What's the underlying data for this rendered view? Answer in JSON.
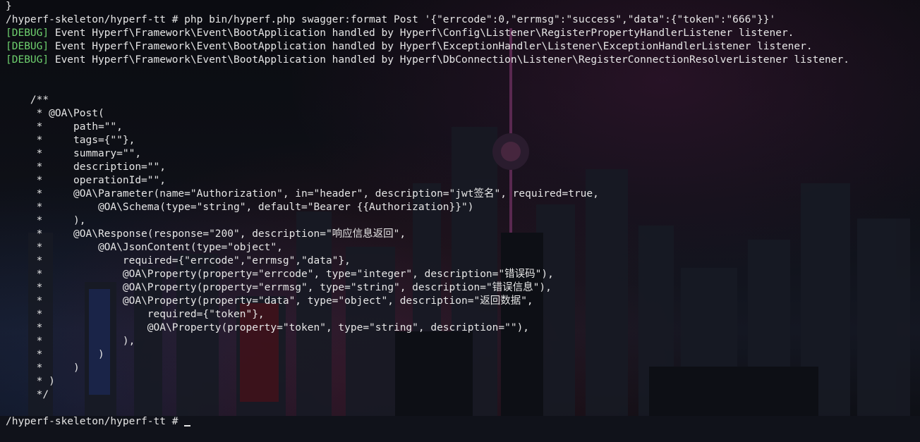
{
  "terminal": {
    "lines": [
      {
        "tag": "",
        "text": "}"
      },
      {
        "tag": "",
        "text": "/hyperf-skeleton/hyperf-tt # php bin/hyperf.php swagger:format Post '{\"errcode\":0,\"errmsg\":\"success\",\"data\":{\"token\":\"666\"}}'"
      },
      {
        "tag": "[DEBUG]",
        "text": " Event Hyperf\\Framework\\Event\\BootApplication handled by Hyperf\\Config\\Listener\\RegisterPropertyHandlerListener listener."
      },
      {
        "tag": "[DEBUG]",
        "text": " Event Hyperf\\Framework\\Event\\BootApplication handled by Hyperf\\ExceptionHandler\\Listener\\ExceptionHandlerListener listener."
      },
      {
        "tag": "[DEBUG]",
        "text": " Event Hyperf\\Framework\\Event\\BootApplication handled by Hyperf\\DbConnection\\Listener\\RegisterConnectionResolverListener listener."
      },
      {
        "tag": "",
        "text": ""
      },
      {
        "tag": "",
        "text": ""
      },
      {
        "tag": "",
        "text": "    /**"
      },
      {
        "tag": "",
        "text": "     * @OA\\Post("
      },
      {
        "tag": "",
        "text": "     *     path=\"\","
      },
      {
        "tag": "",
        "text": "     *     tags={\"\"},"
      },
      {
        "tag": "",
        "text": "     *     summary=\"\","
      },
      {
        "tag": "",
        "text": "     *     description=\"\","
      },
      {
        "tag": "",
        "text": "     *     operationId=\"\","
      },
      {
        "tag": "",
        "text": "     *     @OA\\Parameter(name=\"Authorization\", in=\"header\", description=\"jwt签名\", required=true,"
      },
      {
        "tag": "",
        "text": "     *         @OA\\Schema(type=\"string\", default=\"Bearer {{Authorization}}\")"
      },
      {
        "tag": "",
        "text": "     *     ),"
      },
      {
        "tag": "",
        "text": "     *     @OA\\Response(response=\"200\", description=\"响应信息返回\","
      },
      {
        "tag": "",
        "text": "     *         @OA\\JsonContent(type=\"object\","
      },
      {
        "tag": "",
        "text": "     *             required={\"errcode\",\"errmsg\",\"data\"},"
      },
      {
        "tag": "",
        "text": "     *             @OA\\Property(property=\"errcode\", type=\"integer\", description=\"错误码\"),"
      },
      {
        "tag": "",
        "text": "     *             @OA\\Property(property=\"errmsg\", type=\"string\", description=\"错误信息\"),"
      },
      {
        "tag": "",
        "text": "     *             @OA\\Property(property=\"data\", type=\"object\", description=\"返回数据\","
      },
      {
        "tag": "",
        "text": "     *                 required={\"token\"},"
      },
      {
        "tag": "",
        "text": "     *                 @OA\\Property(property=\"token\", type=\"string\", description=\"\"),"
      },
      {
        "tag": "",
        "text": "     *             ),"
      },
      {
        "tag": "",
        "text": "     *         )"
      },
      {
        "tag": "",
        "text": "     *     )"
      },
      {
        "tag": "",
        "text": "     * )"
      },
      {
        "tag": "",
        "text": "     */"
      },
      {
        "tag": "",
        "text": ""
      },
      {
        "tag": "",
        "text": "/hyperf-skeleton/hyperf-tt # "
      }
    ],
    "tag_color": "#6ed06e",
    "text_color": "#e6e6e6"
  }
}
